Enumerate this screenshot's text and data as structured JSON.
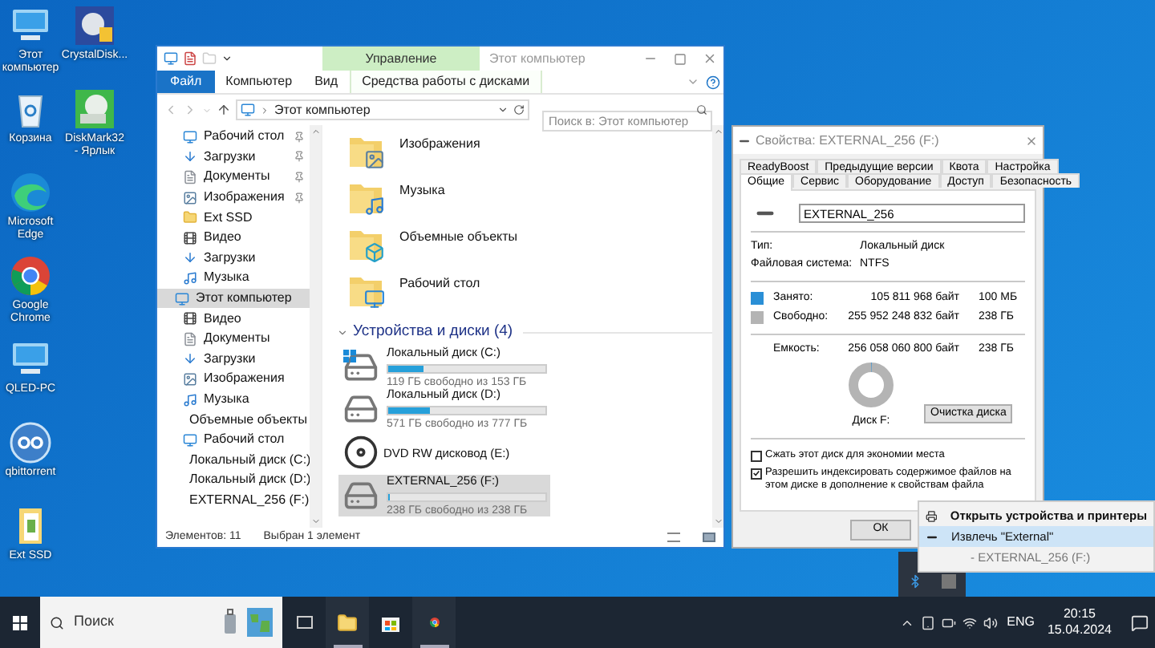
{
  "desktop": {
    "columns": [
      [
        {
          "label": "Этот компьютер",
          "kind": "computer"
        },
        {
          "label": "Корзина",
          "kind": "recycle"
        },
        {
          "label": "Microsoft Edge",
          "kind": "edge"
        },
        {
          "label": "Google Chrome",
          "kind": "chrome"
        },
        {
          "label": "QLED-PC",
          "kind": "computer"
        },
        {
          "label": "qbittorrent",
          "kind": "qb"
        },
        {
          "label": "Ext SSD",
          "kind": "folder"
        }
      ],
      [
        {
          "label": "CrystalDisk...",
          "kind": "crystal"
        },
        {
          "label": "DiskMark32 - Ярлык",
          "kind": "diskmark"
        }
      ]
    ]
  },
  "explorer": {
    "title": "Этот компьютер",
    "context_header": "Управление",
    "ribbon_tabs": [
      {
        "label": "Файл",
        "kind": "file"
      },
      {
        "label": "Компьютер",
        "kind": "plain"
      },
      {
        "label": "Вид",
        "kind": "plain"
      },
      {
        "label": "Средства работы с дисками",
        "kind": "contextual"
      }
    ],
    "address": "Этот компьютер",
    "search": {
      "placeholder": "Поиск в: Этот компьютер"
    },
    "nav": [
      {
        "label": "Рабочий стол",
        "kind": "desktop",
        "pinned": true,
        "selected": false
      },
      {
        "label": "Загрузки",
        "kind": "downloads",
        "pinned": true,
        "selected": false
      },
      {
        "label": "Документы",
        "kind": "documents",
        "pinned": true,
        "selected": false
      },
      {
        "label": "Изображения",
        "kind": "pictures",
        "pinned": true,
        "selected": false
      },
      {
        "label": "Ext SSD",
        "kind": "folder",
        "pinned": false,
        "selected": false
      },
      {
        "label": "Видео",
        "kind": "video",
        "pinned": false,
        "selected": false
      },
      {
        "label": "Загрузки",
        "kind": "downloads",
        "pinned": false,
        "selected": false
      },
      {
        "label": "Музыка",
        "kind": "music",
        "pinned": false,
        "selected": false
      },
      {
        "label": "Этот компьютер",
        "kind": "computer",
        "pinned": false,
        "selected": true,
        "children": [
          {
            "label": "Видео",
            "kind": "video",
            "selected": false
          },
          {
            "label": "Документы",
            "kind": "documents",
            "selected": false
          },
          {
            "label": "Загрузки",
            "kind": "downloads",
            "selected": false
          },
          {
            "label": "Изображения",
            "kind": "pictures",
            "selected": false
          },
          {
            "label": "Музыка",
            "kind": "music",
            "selected": false
          },
          {
            "label": "Объемные объекты",
            "kind": "objects",
            "selected": false
          },
          {
            "label": "Рабочий стол",
            "kind": "desktop",
            "selected": false
          },
          {
            "label": "Локальный диск (C:)",
            "kind": "disk",
            "selected": false
          },
          {
            "label": "Локальный диск (D:)",
            "kind": "disk",
            "selected": false
          },
          {
            "label": "EXTERNAL_256 (F:)",
            "kind": "usb",
            "selected": false
          }
        ]
      }
    ],
    "folders": [
      {
        "label": "Изображения",
        "kind": "pictures"
      },
      {
        "label": "Музыка",
        "kind": "music"
      },
      {
        "label": "Объемные объекты",
        "kind": "objects"
      },
      {
        "label": "Рабочий стол",
        "kind": "desktop"
      }
    ],
    "devices_header": "Устройства и диски (4)",
    "drives": [
      {
        "label": "Локальный диск (C:)",
        "kind": "system",
        "level": 0.22,
        "free": "119 ГБ свободно из 153 ГБ",
        "selected": false
      },
      {
        "label": "Локальный диск (D:)",
        "kind": "disk",
        "level": 0.27,
        "free": "571 ГБ свободно из 777 ГБ",
        "selected": false
      },
      {
        "label": "DVD RW дисковод (E:)",
        "kind": "dvd",
        "selected": false
      },
      {
        "label": "EXTERNAL_256 (F:)",
        "kind": "disk",
        "level": 0.004,
        "free": "238 ГБ свободно из 238 ГБ",
        "selected": true
      }
    ],
    "status": [
      "Элементов: 11",
      "Выбран 1 элемент"
    ]
  },
  "properties": {
    "title": "Свойства: EXTERNAL_256 (F:)",
    "tabs_back": [
      {
        "label": "ReadyBoost",
        "selected": false
      },
      {
        "label": "Предыдущие версии",
        "selected": false
      },
      {
        "label": "Квота",
        "selected": false
      },
      {
        "label": "Настройка",
        "selected": false
      }
    ],
    "tabs_front": [
      {
        "label": "Общие",
        "selected": true
      },
      {
        "label": "Сервис",
        "selected": false
      },
      {
        "label": "Оборудование",
        "selected": false
      },
      {
        "label": "Доступ",
        "selected": false
      },
      {
        "label": "Безопасность",
        "selected": false
      }
    ],
    "name": "EXTERNAL_256",
    "info": [
      {
        "label": "Тип:",
        "value": "Локальный диск"
      },
      {
        "label": "Файловая система:",
        "value": "NTFS"
      }
    ],
    "space": [
      {
        "label": "Занято:",
        "bytes": "105 811 968 байт",
        "size": "100 МБ",
        "color": "#2a8fd6"
      },
      {
        "label": "Свободно:",
        "bytes": "255 952 248 832 байт",
        "size": "238 ГБ",
        "color": "#b4b4b4"
      }
    ],
    "capacity": {
      "label": "Емкость:",
      "bytes": "256 058 060 800 байт",
      "size": "238 ГБ"
    },
    "usage": {
      "level": 0.004
    },
    "disk_label": "Диск F:",
    "cleanup_button": "Очистка диска",
    "options": [
      {
        "label": "Сжать этот диск для экономии места",
        "checked": false
      },
      {
        "label": "Разрешить индексировать содержимое файлов на этом диске в дополнение к свойствам файла",
        "checked": true
      }
    ],
    "ok_button": "ОК"
  },
  "tray_menu": [
    {
      "label": "Открыть устройства и принтеры",
      "kind": "header",
      "selected": false
    },
    {
      "label": "Извлечь \"External\"",
      "kind": "eject",
      "selected": true
    },
    {
      "label": "- EXTERNAL_256 (F:)",
      "kind": "sub",
      "selected": false
    }
  ],
  "taskbar": {
    "search_placeholder": "Поиск",
    "apps": [
      {
        "kind": "taskview",
        "running": false
      },
      {
        "kind": "explorer",
        "running": true
      },
      {
        "kind": "store",
        "running": false
      },
      {
        "kind": "chrome",
        "running": true
      }
    ],
    "language": "ENG",
    "time": "20:15",
    "date": "15.04.2024"
  }
}
